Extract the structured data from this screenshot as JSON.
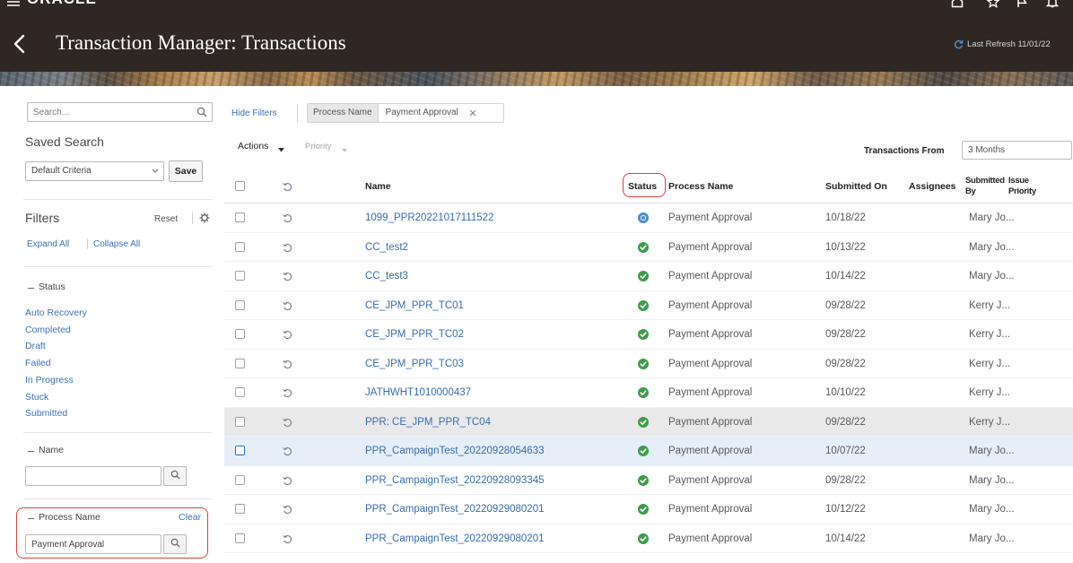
{
  "header": {
    "brand": "ORACLE",
    "menu_icon": "hamburger-icon",
    "global_icons": [
      "home-icon",
      "star-icon",
      "flag-icon",
      "bell-icon"
    ]
  },
  "page": {
    "back_icon": "back-icon",
    "title": "Transaction Manager: Transactions",
    "refresh_icon": "refresh-icon",
    "last_refresh": "Last Refresh 11/01/22"
  },
  "sidebar": {
    "search": {
      "placeholder": "Search...",
      "icon": "search-icon"
    },
    "saved_search": {
      "label": "Saved Search",
      "value": "Default Criteria",
      "save_label": "Save"
    },
    "filters": {
      "label": "Filters",
      "reset_label": "Reset",
      "settings_icon": "gear-icon",
      "expand_all": "Expand All",
      "collapse_all": "Collapse All"
    },
    "status": {
      "label": "Status",
      "items": [
        "Auto Recovery",
        "Completed",
        "Draft",
        "Failed",
        "In Progress",
        "Stuck",
        "Submitted"
      ]
    },
    "name": {
      "label": "Name"
    },
    "process_name": {
      "label": "Process Name",
      "clear_label": "Clear",
      "value": "Payment Approval"
    }
  },
  "toolbar": {
    "hide_filters": "Hide Filters",
    "applied_filter": {
      "label": "Process Name",
      "value": "Payment Approval",
      "remove_icon": "close-icon"
    },
    "actions": "Actions",
    "priority": "Priority",
    "transactions_from": {
      "label": "Transactions From",
      "value": "3 Months"
    }
  },
  "table": {
    "columns": {
      "name": "Name",
      "status": "Status",
      "process_name": "Process Name",
      "submitted_on": "Submitted On",
      "assignees": "Assignees",
      "submitted_by": "Submitted By",
      "issue_priority": "Issue Priority"
    },
    "rows": [
      {
        "name": "1099_PPR20221017111522",
        "status_icon": "info-circle-icon",
        "process_name": "Payment Approval",
        "submitted_on": "10/18/22",
        "submitted_by": "Mary Jo..."
      },
      {
        "name": "CC_test2",
        "status_icon": "check-circle-icon",
        "process_name": "Payment Approval",
        "submitted_on": "10/13/22",
        "submitted_by": "Mary Jo..."
      },
      {
        "name": "CC_test3",
        "status_icon": "check-circle-icon",
        "process_name": "Payment Approval",
        "submitted_on": "10/14/22",
        "submitted_by": "Mary Jo..."
      },
      {
        "name": "CE_JPM_PPR_TC01",
        "status_icon": "check-circle-icon",
        "process_name": "Payment Approval",
        "submitted_on": "09/28/22",
        "submitted_by": "Kerry J..."
      },
      {
        "name": "CE_JPM_PPR_TC02",
        "status_icon": "check-circle-icon",
        "process_name": "Payment Approval",
        "submitted_on": "09/28/22",
        "submitted_by": "Kerry J..."
      },
      {
        "name": "CE_JPM_PPR_TC03",
        "status_icon": "check-circle-icon",
        "process_name": "Payment Approval",
        "submitted_on": "09/28/22",
        "submitted_by": "Kerry J..."
      },
      {
        "name": "JATHWHT1010000437",
        "status_icon": "check-circle-icon",
        "process_name": "Payment Approval",
        "submitted_on": "10/10/22",
        "submitted_by": "Kerry J..."
      },
      {
        "name": "PPR: CE_JPM_PPR_TC04",
        "status_icon": "check-circle-icon",
        "process_name": "Payment Approval",
        "submitted_on": "09/28/22",
        "submitted_by": "Kerry J...",
        "highlighted": true
      },
      {
        "name": "PPR_CampaignTest_20220928054633",
        "status_icon": "check-circle-icon",
        "process_name": "Payment Approval",
        "submitted_on": "10/07/22",
        "submitted_by": "Mary Jo...",
        "selected": true
      },
      {
        "name": "PPR_CampaignTest_20220928093345",
        "status_icon": "check-circle-icon",
        "process_name": "Payment Approval",
        "submitted_on": "09/28/22",
        "submitted_by": "Mary Jo..."
      },
      {
        "name": "PPR_CampaignTest_20220929080201",
        "status_icon": "check-circle-icon",
        "process_name": "Payment Approval",
        "submitted_on": "10/12/22",
        "submitted_by": "Mary Jo..."
      },
      {
        "name": "PPR_CampaignTest_20220929080201",
        "status_icon": "check-circle-icon",
        "process_name": "Payment Approval",
        "submitted_on": "10/14/22",
        "submitted_by": "Mary Jo..."
      }
    ]
  },
  "colors": {
    "header_bg": "#2f2723",
    "link": "#3f72b5",
    "success": "#3e9c4b",
    "info": "#4b8ccb",
    "annotation_red": "#d8443a",
    "row_highlight": "#e9e9e9",
    "row_selected": "#e5eef9"
  }
}
